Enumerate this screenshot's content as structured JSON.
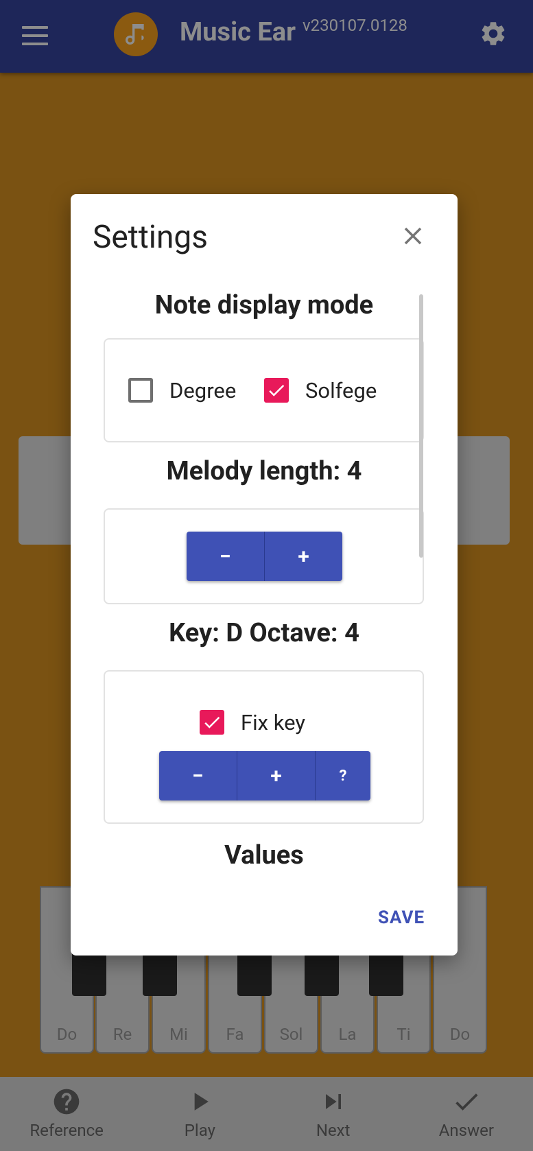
{
  "appbar": {
    "title": "Music Ear",
    "version": "v230107.0128",
    "icons": [
      "menu-icon",
      "music-note-icon",
      "gear-icon"
    ]
  },
  "piano": {
    "white_keys": [
      "Do",
      "Re",
      "Mi",
      "Fa",
      "Sol",
      "La",
      "Ti",
      "Do"
    ]
  },
  "bottom_nav": [
    {
      "label": "Reference",
      "icon": "help-circle-icon"
    },
    {
      "label": "Play",
      "icon": "play-icon"
    },
    {
      "label": "Next",
      "icon": "skip-next-icon"
    },
    {
      "label": "Answer",
      "icon": "check-icon"
    }
  ],
  "dialog": {
    "title": "Settings",
    "note_display": {
      "title": "Note display mode",
      "options": [
        {
          "label": "Degree",
          "checked": false
        },
        {
          "label": "Solfege",
          "checked": true
        }
      ]
    },
    "melody_length": {
      "title": "Melody length: 4",
      "buttons": [
        "−",
        "+"
      ]
    },
    "key": {
      "title": "Key: D Octave: 4",
      "fix_key": {
        "label": "Fix key",
        "checked": true
      },
      "buttons": [
        "−",
        "+",
        "?"
      ]
    },
    "values_title": "Values",
    "save_label": "SAVE"
  },
  "colors": {
    "appbar": "#1e2659",
    "background": "#7a5212",
    "accent_pink": "#e8195a",
    "primary_blue": "#3f51b5"
  }
}
